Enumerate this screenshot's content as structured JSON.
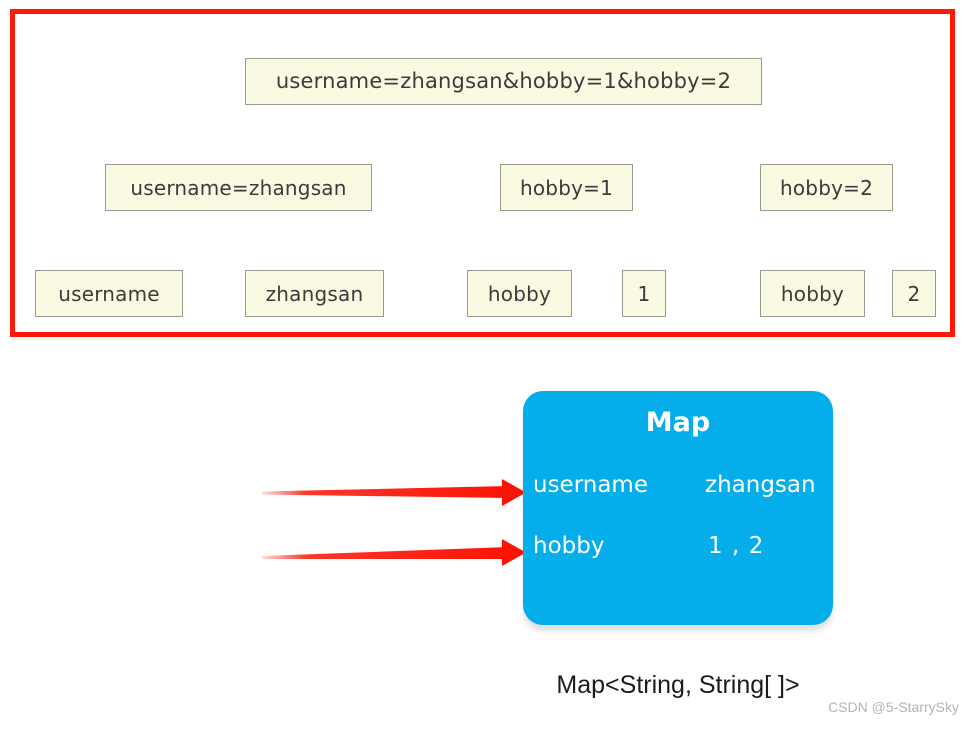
{
  "diagram": {
    "query_string": "username=zhangsan&hobby=1&hobby=2",
    "pairs": [
      {
        "label": "username=zhangsan"
      },
      {
        "label": "hobby=1"
      },
      {
        "label": "hobby=2"
      }
    ],
    "tokens": [
      {
        "label": "username"
      },
      {
        "label": "zhangsan"
      },
      {
        "label": "hobby"
      },
      {
        "label": "1"
      },
      {
        "label": "hobby"
      },
      {
        "label": "2"
      }
    ],
    "colors": {
      "region_border": "#fc1a07",
      "box_fill": "#fafae2",
      "box_border": "#9a9a8c",
      "map_fill": "#05aeea",
      "arrow": "#fb1405"
    }
  },
  "map_card": {
    "title": "Map",
    "entries": [
      {
        "key": "username",
        "value": "zhangsan"
      },
      {
        "key": "hobby",
        "value": "1 , 2"
      }
    ],
    "caption": "Map<String, String[ ]>"
  },
  "watermark": {
    "text": "CSDN @5-StarrySky"
  }
}
